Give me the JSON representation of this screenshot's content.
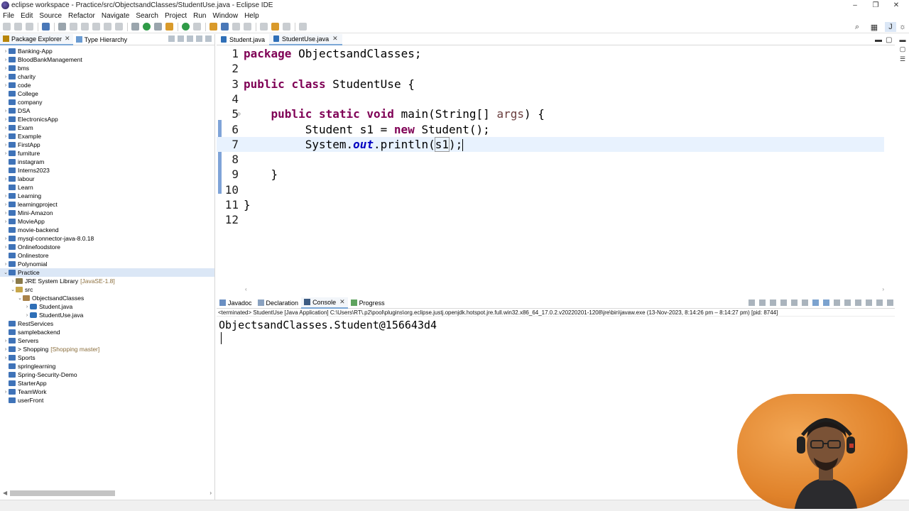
{
  "window": {
    "title": "eclipse workspace - Practice/src/ObjectsandClasses/StudentUse.java - Eclipse IDE",
    "minimize": "–",
    "maximize": "❐",
    "close": "✕"
  },
  "menu": [
    "File",
    "Edit",
    "Source",
    "Refactor",
    "Navigate",
    "Search",
    "Project",
    "Run",
    "Window",
    "Help"
  ],
  "package_explorer": {
    "tabs": [
      {
        "label": "Package Explorer",
        "active": true
      },
      {
        "label": "Type Hierarchy",
        "active": false
      }
    ],
    "items": [
      {
        "label": "Banking-App",
        "level": 0,
        "expandable": true
      },
      {
        "label": "BloodBankManagement",
        "level": 0,
        "expandable": true
      },
      {
        "label": "bms",
        "level": 0,
        "expandable": true
      },
      {
        "label": "charity",
        "level": 0,
        "expandable": true
      },
      {
        "label": "code",
        "level": 0,
        "expandable": true
      },
      {
        "label": "College",
        "level": 0,
        "expandable": false
      },
      {
        "label": "company",
        "level": 0,
        "expandable": false
      },
      {
        "label": "DSA",
        "level": 0,
        "expandable": true
      },
      {
        "label": "ElectronicsApp",
        "level": 0,
        "expandable": true
      },
      {
        "label": "Exam",
        "level": 0,
        "expandable": true
      },
      {
        "label": "Example",
        "level": 0,
        "expandable": true
      },
      {
        "label": "FirstApp",
        "level": 0,
        "expandable": true
      },
      {
        "label": "furniture",
        "level": 0,
        "expandable": true
      },
      {
        "label": "instagram",
        "level": 0,
        "expandable": false
      },
      {
        "label": "Interns2023",
        "level": 0,
        "expandable": false
      },
      {
        "label": "labour",
        "level": 0,
        "expandable": true
      },
      {
        "label": "Learn",
        "level": 0,
        "expandable": false
      },
      {
        "label": "Learning",
        "level": 0,
        "expandable": true
      },
      {
        "label": "learningproject",
        "level": 0,
        "expandable": true
      },
      {
        "label": "Mini-Amazon",
        "level": 0,
        "expandable": true
      },
      {
        "label": "MovieApp",
        "level": 0,
        "expandable": true
      },
      {
        "label": "movie-backend",
        "level": 0,
        "expandable": false
      },
      {
        "label": "mysql-connector-java-8.0.18",
        "level": 0,
        "expandable": true
      },
      {
        "label": "Onlinefoodstore",
        "level": 0,
        "expandable": true
      },
      {
        "label": "Onlinestore",
        "level": 0,
        "expandable": false
      },
      {
        "label": "Polynomial",
        "level": 0,
        "expandable": true
      },
      {
        "label": "Practice",
        "level": 0,
        "expandable": true,
        "expanded": true,
        "selected": true
      },
      {
        "label": "JRE System Library",
        "decoration": "[JavaSE-1.8]",
        "level": 1,
        "expandable": true,
        "icon": "jre"
      },
      {
        "label": "src",
        "level": 1,
        "expandable": true,
        "expanded": true,
        "icon": "pkgf"
      },
      {
        "label": "ObjectsandClasses",
        "level": 2,
        "expandable": true,
        "expanded": true,
        "icon": "pkg"
      },
      {
        "label": "Student.java",
        "level": 3,
        "expandable": true,
        "icon": "jfile"
      },
      {
        "label": "StudentUse.java",
        "level": 3,
        "expandable": true,
        "icon": "jfile"
      },
      {
        "label": "RestServices",
        "level": 0,
        "expandable": false
      },
      {
        "label": "samplebackend",
        "level": 0,
        "expandable": false
      },
      {
        "label": "Servers",
        "level": 0,
        "expandable": true
      },
      {
        "label": "> Shopping",
        "decoration": "[Shopping master]",
        "level": 0,
        "expandable": true
      },
      {
        "label": "Sports",
        "level": 0,
        "expandable": true
      },
      {
        "label": "springlearning",
        "level": 0,
        "expandable": false
      },
      {
        "label": "Spring-Security-Demo",
        "level": 0,
        "expandable": false
      },
      {
        "label": "StarterApp",
        "level": 0,
        "expandable": false
      },
      {
        "label": "TeamWork",
        "level": 0,
        "expandable": true
      },
      {
        "label": "userFront",
        "level": 0,
        "expandable": false
      }
    ]
  },
  "editor": {
    "tabs": [
      {
        "label": "Student.java",
        "active": false
      },
      {
        "label": "StudentUse.java",
        "active": true
      }
    ],
    "current_line": 7,
    "lines": [
      {
        "n": "1",
        "tokens": [
          {
            "t": "package",
            "c": "kw"
          },
          {
            "t": " ObjectsandClasses;"
          }
        ]
      },
      {
        "n": "2",
        "tokens": []
      },
      {
        "n": "3",
        "tokens": [
          {
            "t": "public",
            "c": "kw"
          },
          {
            "t": " "
          },
          {
            "t": "class",
            "c": "kw"
          },
          {
            "t": " StudentUse {"
          }
        ]
      },
      {
        "n": "4",
        "tokens": []
      },
      {
        "n": "5",
        "tokens": [
          {
            "t": "    "
          },
          {
            "t": "public",
            "c": "kw"
          },
          {
            "t": " "
          },
          {
            "t": "static",
            "c": "kw"
          },
          {
            "t": " "
          },
          {
            "t": "void",
            "c": "kw"
          },
          {
            "t": " main(String[] "
          },
          {
            "t": "args",
            "c": "par"
          },
          {
            "t": ") {"
          }
        ]
      },
      {
        "n": "6",
        "tokens": [
          {
            "t": "         Student s1 = "
          },
          {
            "t": "new",
            "c": "kw"
          },
          {
            "t": " Student();"
          }
        ]
      },
      {
        "n": "7",
        "tokens": [
          {
            "t": "         System."
          },
          {
            "t": "out",
            "c": "fld"
          },
          {
            "t": ".println("
          },
          {
            "t": "s1",
            "c": "box"
          },
          {
            "t": ");"
          }
        ]
      },
      {
        "n": "8",
        "tokens": []
      },
      {
        "n": "9",
        "tokens": [
          {
            "t": "    }"
          }
        ]
      },
      {
        "n": "10",
        "tokens": []
      },
      {
        "n": "11",
        "tokens": [
          {
            "t": "}"
          }
        ]
      },
      {
        "n": "12",
        "tokens": []
      }
    ]
  },
  "bottom_panel": {
    "tabs": [
      {
        "label": "Javadoc",
        "active": false
      },
      {
        "label": "Declaration",
        "active": false
      },
      {
        "label": "Console",
        "active": true
      },
      {
        "label": "Progress",
        "active": false
      }
    ],
    "terminated_line": "<terminated> StudentUse [Java Application] C:\\Users\\RT\\.p2\\pool\\plugins\\org.eclipse.justj.openjdk.hotspot.jre.full.win32.x86_64_17.0.2.v20220201-1208\\jre\\bin\\javaw.exe  (13-Nov-2023, 8:14:26 pm – 8:14:27 pm) [pid: 8744]",
    "output": "ObjectsandClasses.Student@156643d4"
  },
  "colors": {
    "keyword": "#7f0055",
    "field": "#0000c0",
    "current_line": "#e8f2fe",
    "selection": "#dbe7f6",
    "webcam_bg": "#e0822a"
  }
}
